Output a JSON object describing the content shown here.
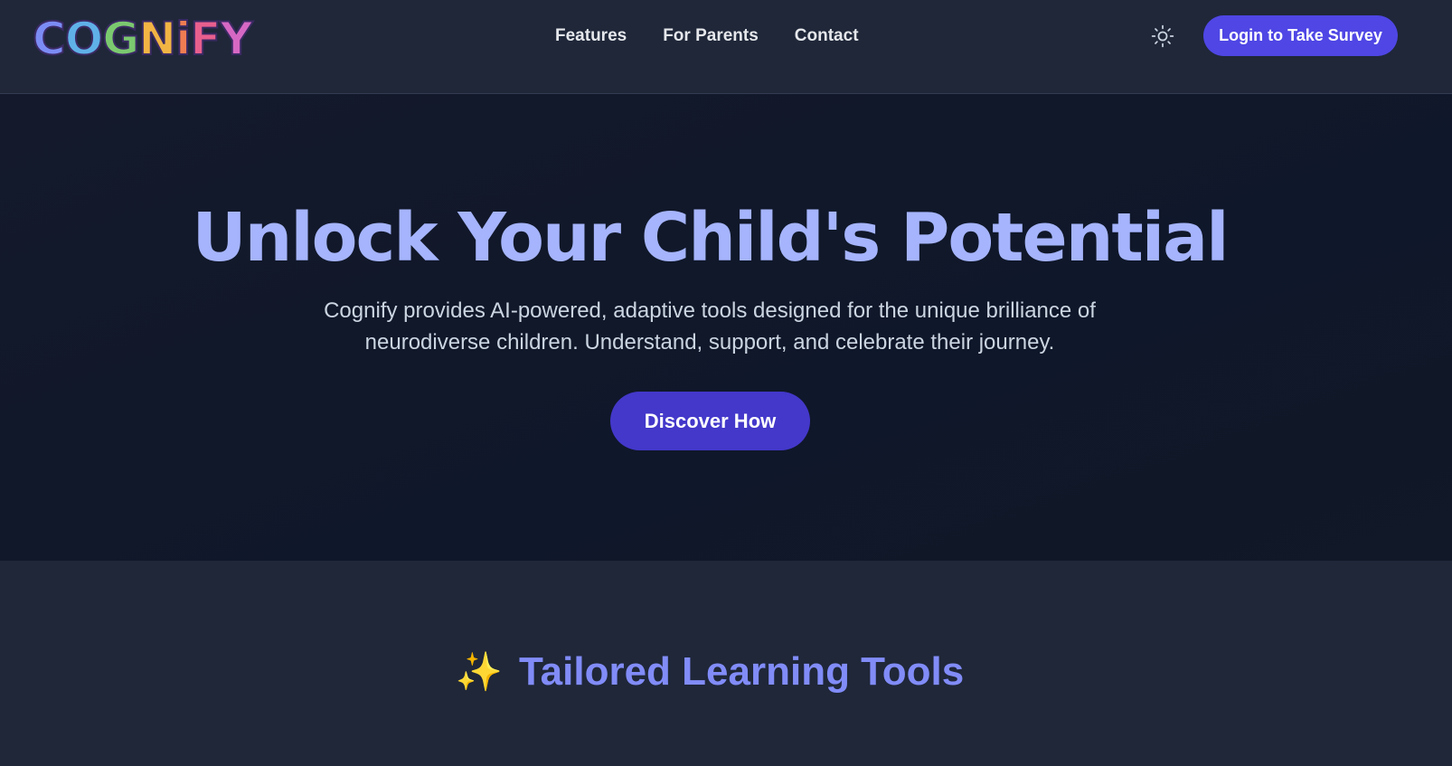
{
  "brand": {
    "logo_text": "COGNiFY",
    "logo_letters": [
      {
        "ch": "C",
        "color": "#7c8cf5"
      },
      {
        "ch": "O",
        "color": "#5fb1e8"
      },
      {
        "ch": "G",
        "color": "#7bc96f"
      },
      {
        "ch": "N",
        "color": "#f2b544"
      },
      {
        "ch": "i",
        "color": "#f07d52"
      },
      {
        "ch": "F",
        "color": "#e85f8e"
      },
      {
        "ch": "Y",
        "color": "#d668c4"
      }
    ]
  },
  "nav": {
    "items": [
      {
        "label": "Features"
      },
      {
        "label": "For Parents"
      },
      {
        "label": "Contact"
      }
    ]
  },
  "header": {
    "theme_icon": "sun-icon",
    "login_label": "Login to Take Survey"
  },
  "hero": {
    "title": "Unlock Your Child's Potential",
    "subtitle": "Cognify provides AI-powered, adaptive tools designed for the unique brilliance of neurodiverse children. Understand, support, and celebrate their journey.",
    "cta_label": "Discover How"
  },
  "tools": {
    "icon": "✨",
    "title": "Tailored Learning Tools"
  },
  "colors": {
    "accent": "#4f46e5",
    "hero_title": "#a5b4fc",
    "section_title": "#818cf8",
    "header_bg": "#1f2739",
    "hero_bg": "#0f172a"
  }
}
